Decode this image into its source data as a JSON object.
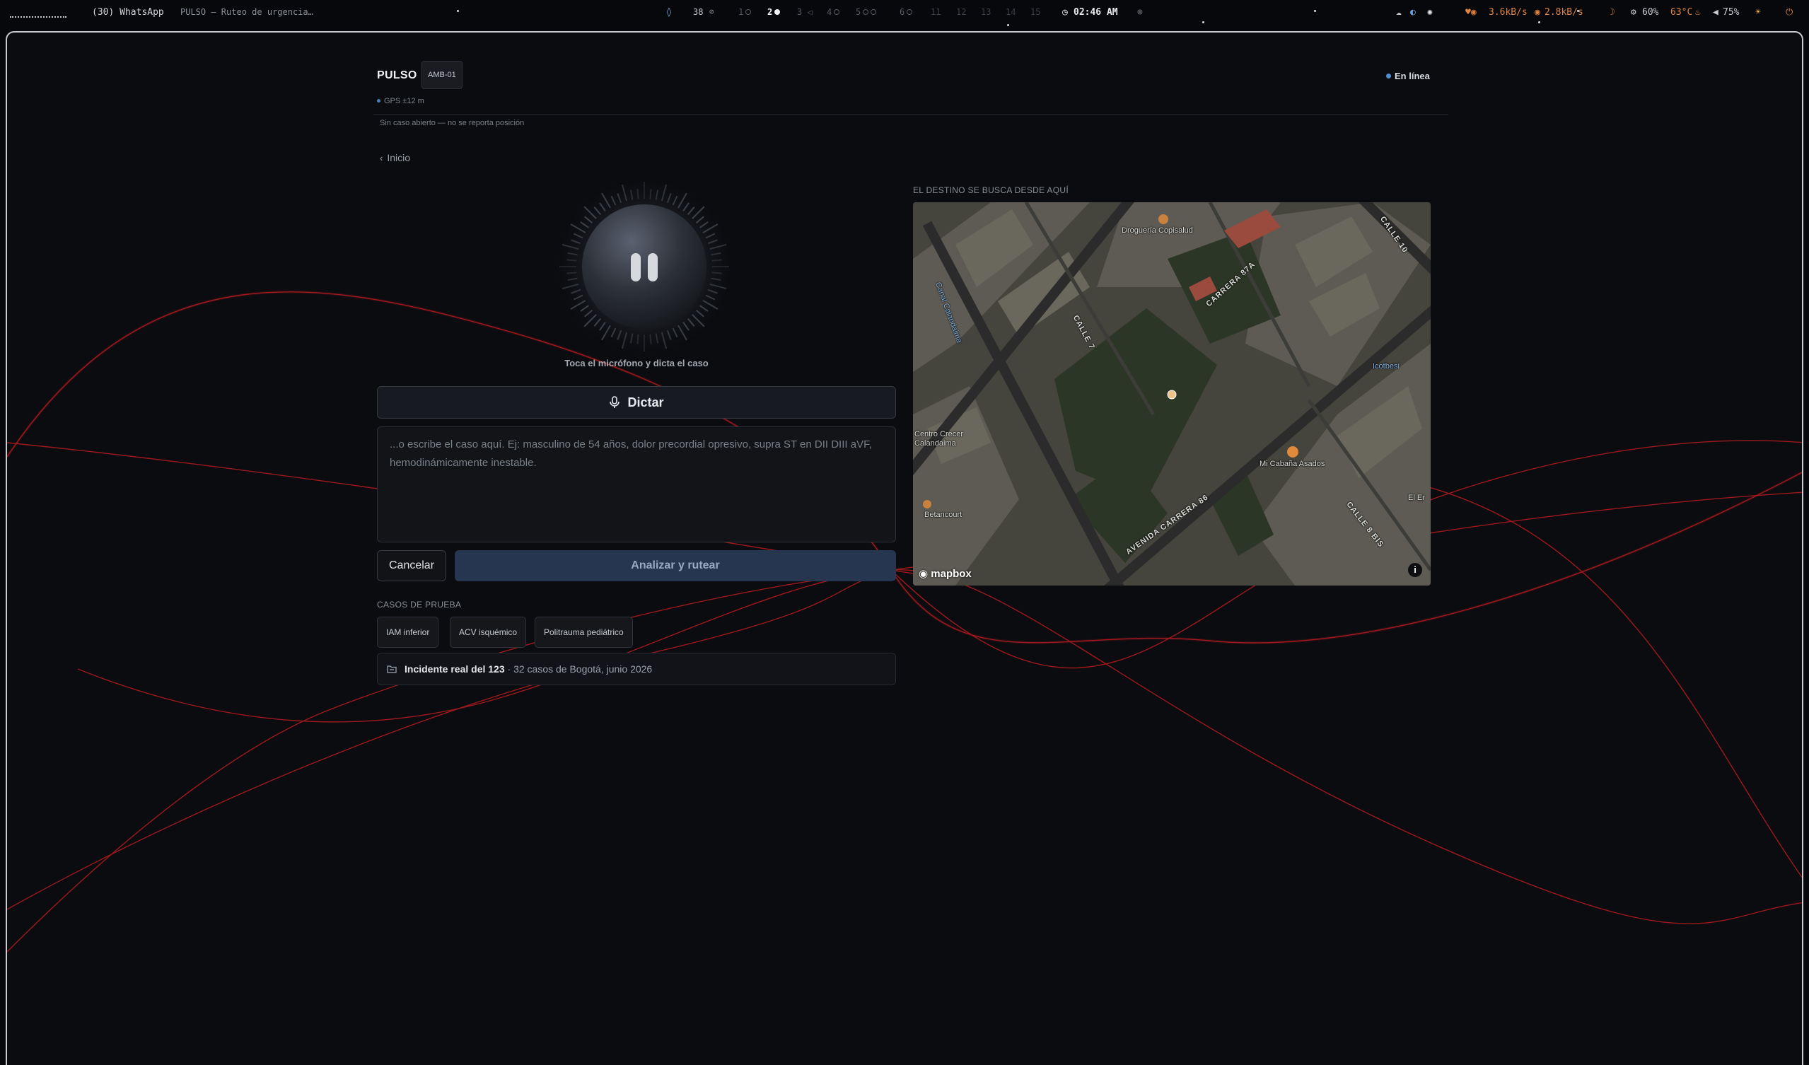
{
  "system_bar": {
    "active_window": "(30) WhatsApp",
    "window_title": "PULSO — Ruteo de urgencia…",
    "notif_count": "38",
    "workspaces": [
      "1",
      "2",
      "3",
      "4",
      "5",
      "6",
      "11",
      "12",
      "13",
      "14",
      "15"
    ],
    "active_workspace": "2",
    "clock": "02:46 AM",
    "net_down": "3.6kB/s",
    "net_up": "2.8kB/s",
    "cpu": "60%",
    "temp": "63°C",
    "volume": "75%"
  },
  "header": {
    "brand": "PULSO",
    "unit": "AMB-01",
    "gps": "GPS ±12 m",
    "status": "En línea",
    "no_case": "Sin caso abierto — no se reporta posición"
  },
  "nav": {
    "back": "Inicio"
  },
  "mic": {
    "hint": "Toca el micrófono y dicta el caso"
  },
  "dictate": {
    "label": "Dictar"
  },
  "case_input": {
    "placeholder": "...o escribe el caso aquí. Ej: masculino de 54 años, dolor precordial opresivo, supra ST en DII DIII aVF, hemodinámicamente inestable.",
    "value": ""
  },
  "actions": {
    "cancel": "Cancelar",
    "analyze": "Analizar y rutear"
  },
  "tests": {
    "label": "CASOS DE PRUEBA",
    "items": [
      "IAM inferior",
      "ACV isquémico",
      "Politrauma pediátrico"
    ]
  },
  "incident": {
    "title": "Incidente real del 123",
    "detail": " · 32 casos de Bogotá, junio 2026"
  },
  "map": {
    "label": "EL DESTINO SE BUSCA DESDE AQUÍ",
    "labels": {
      "drogueria": "Droguería Copisalud",
      "carrera87a": "CARRERA 87A",
      "calle7": "CALLE 7",
      "calle10": "CALLE 10",
      "mi_cabana": "Mi Cabaña Asados",
      "centro_crecer": "Centro Crecer Calandaima",
      "betancourt": "Betancourt",
      "av_carrera86": "AVENIDA CARRERA 86",
      "calle_bis": "CALLE 8 BIS",
      "icotbesi": "Icotbesi",
      "el_er": "El Er",
      "canal": "Canal Calandaima"
    },
    "attribution": "mapbox",
    "info": "i"
  }
}
